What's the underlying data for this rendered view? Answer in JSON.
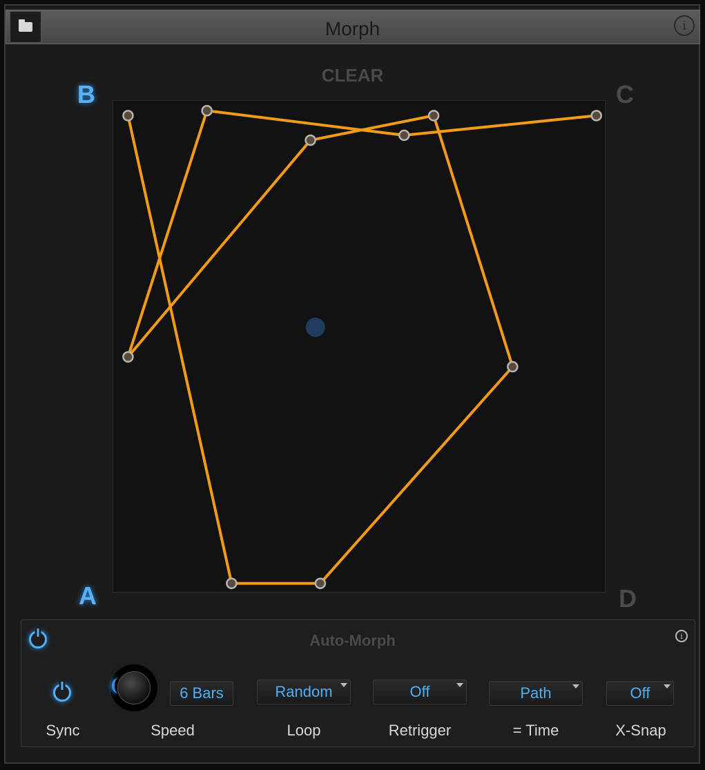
{
  "window": {
    "title": "Morph",
    "folder_icon": "folder-icon",
    "info_icon": "info-icon",
    "info_glyph": "i"
  },
  "pad": {
    "clear_label": "CLEAR",
    "corners": {
      "a": "A",
      "b": "B",
      "c": "C",
      "d": "D"
    },
    "active_color": "#5ab2f5",
    "path_color": "#f39b14",
    "path_points": [
      [
        0.98,
        0.97
      ],
      [
        0.59,
        0.93
      ],
      [
        0.19,
        0.98
      ],
      [
        0.03,
        0.48
      ],
      [
        0.4,
        0.92
      ],
      [
        0.65,
        0.97
      ],
      [
        0.81,
        0.46
      ],
      [
        0.42,
        0.02
      ],
      [
        0.24,
        0.02
      ],
      [
        0.03,
        0.97
      ]
    ],
    "cursor": [
      0.41,
      0.54
    ]
  },
  "auto_morph": {
    "title": "Auto-Morph",
    "enabled": true,
    "sync_on": true,
    "speed_value": "6 Bars",
    "loop_value": "Random",
    "retrigger_value": "Off",
    "time_value": "Path",
    "xsnap_value": "Off",
    "labels": {
      "sync": "Sync",
      "speed": "Speed",
      "loop": "Loop",
      "retrigger": "Retrigger",
      "time": "= Time",
      "xsnap": "X-Snap"
    }
  }
}
